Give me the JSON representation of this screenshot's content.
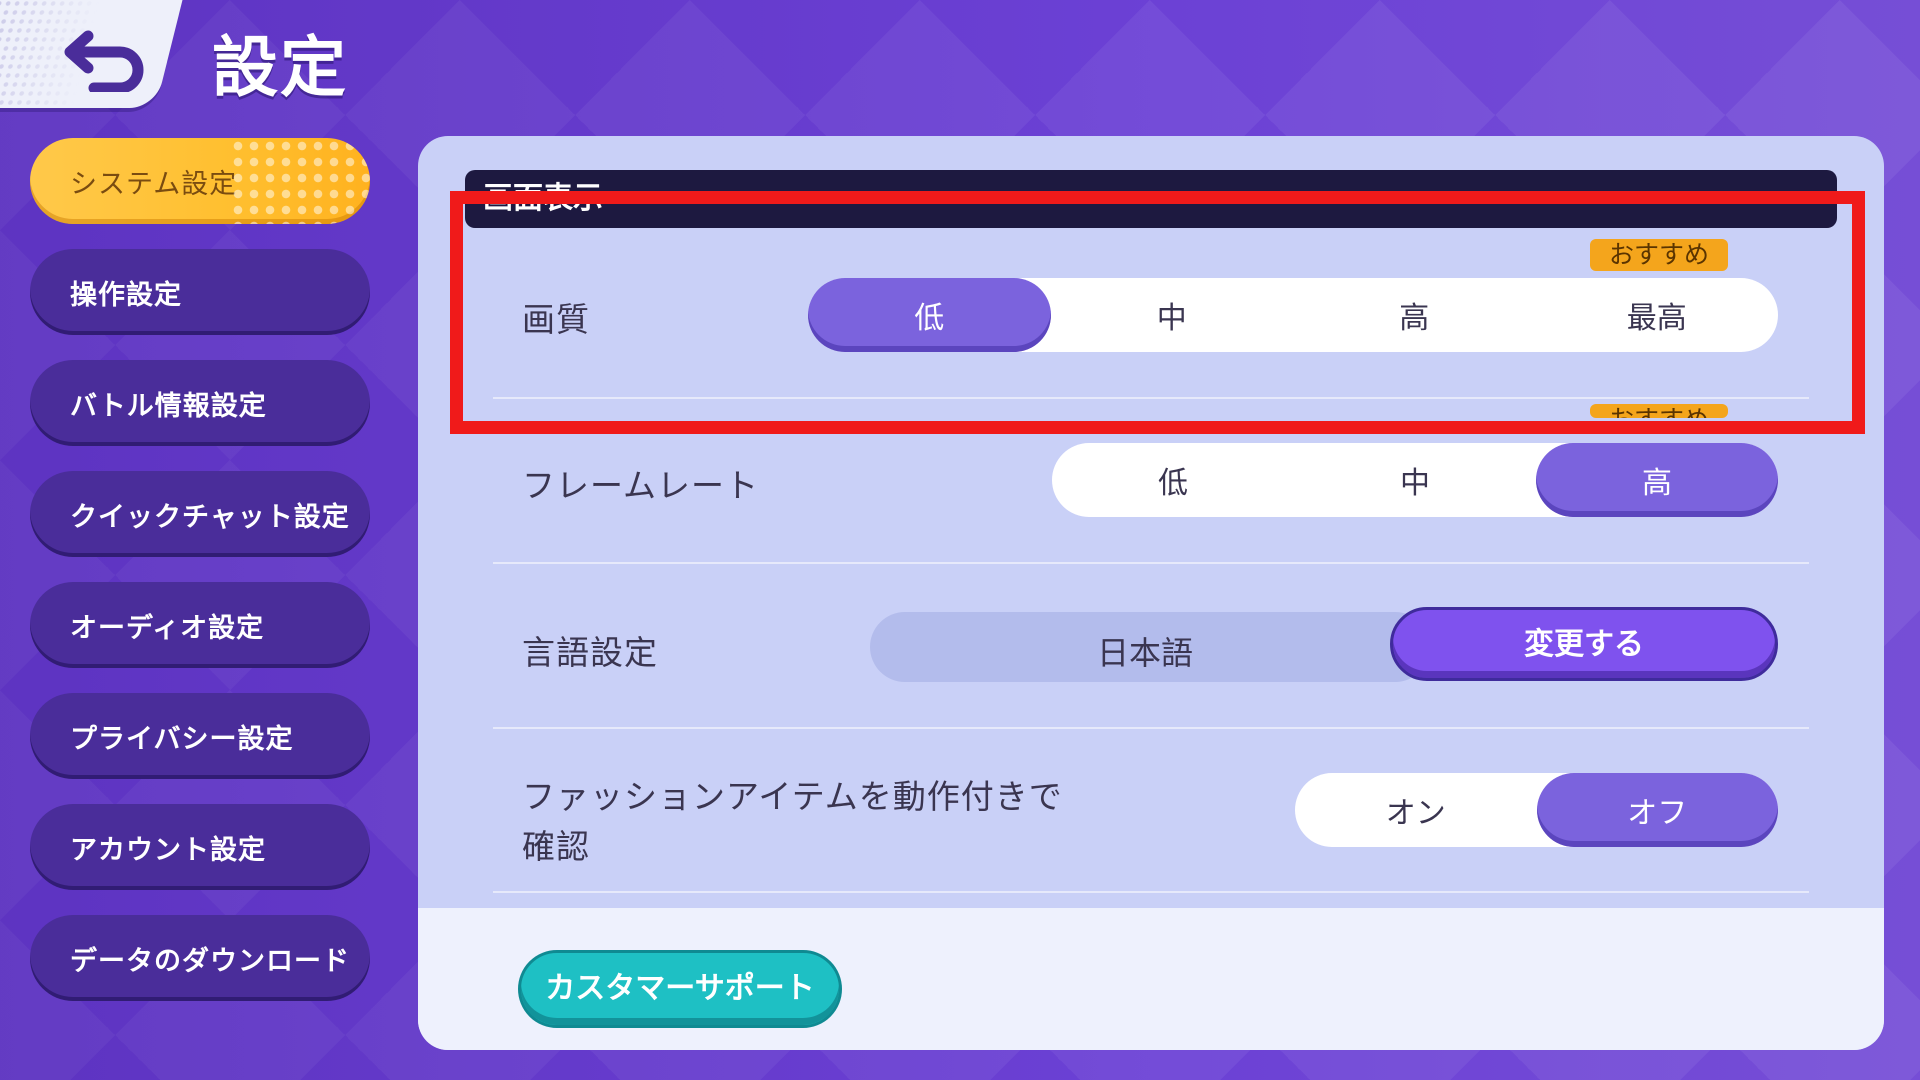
{
  "header": {
    "title": "設定",
    "back_icon": "back-arrow-icon"
  },
  "sidebar": {
    "items": [
      {
        "label": "システム設定",
        "active": true
      },
      {
        "label": "操作設定",
        "active": false
      },
      {
        "label": "バトル情報設定",
        "active": false
      },
      {
        "label": "クイックチャット設定",
        "active": false
      },
      {
        "label": "オーディオ設定",
        "active": false
      },
      {
        "label": "プライバシー設定",
        "active": false
      },
      {
        "label": "アカウント設定",
        "active": false
      },
      {
        "label": "データのダウンロード",
        "active": false
      }
    ]
  },
  "main": {
    "section_title": "画面表示",
    "image_quality": {
      "label": "画質",
      "badge": "おすすめ",
      "options": [
        "低",
        "中",
        "高",
        "最高"
      ],
      "selected": "低"
    },
    "frame_rate": {
      "label": "フレームレート",
      "badge": "おすすめ",
      "options": [
        "低",
        "中",
        "高"
      ],
      "selected": "高"
    },
    "language": {
      "label": "言語設定",
      "value": "日本語",
      "button": "変更する"
    },
    "fashion_preview": {
      "label_line1": "ファッションアイテムを動作付きで",
      "label_line2": "確認",
      "options": [
        "オン",
        "オフ"
      ],
      "selected": "オフ"
    },
    "support_button": "カスタマーサポート"
  },
  "colors": {
    "background": "#6a3fd3",
    "active_tab": "#ffbf2f",
    "selected_option": "#7b63dd",
    "badge": "#f4a51c",
    "support_button": "#1ec0c4",
    "highlight_box": "#f01a1a"
  }
}
